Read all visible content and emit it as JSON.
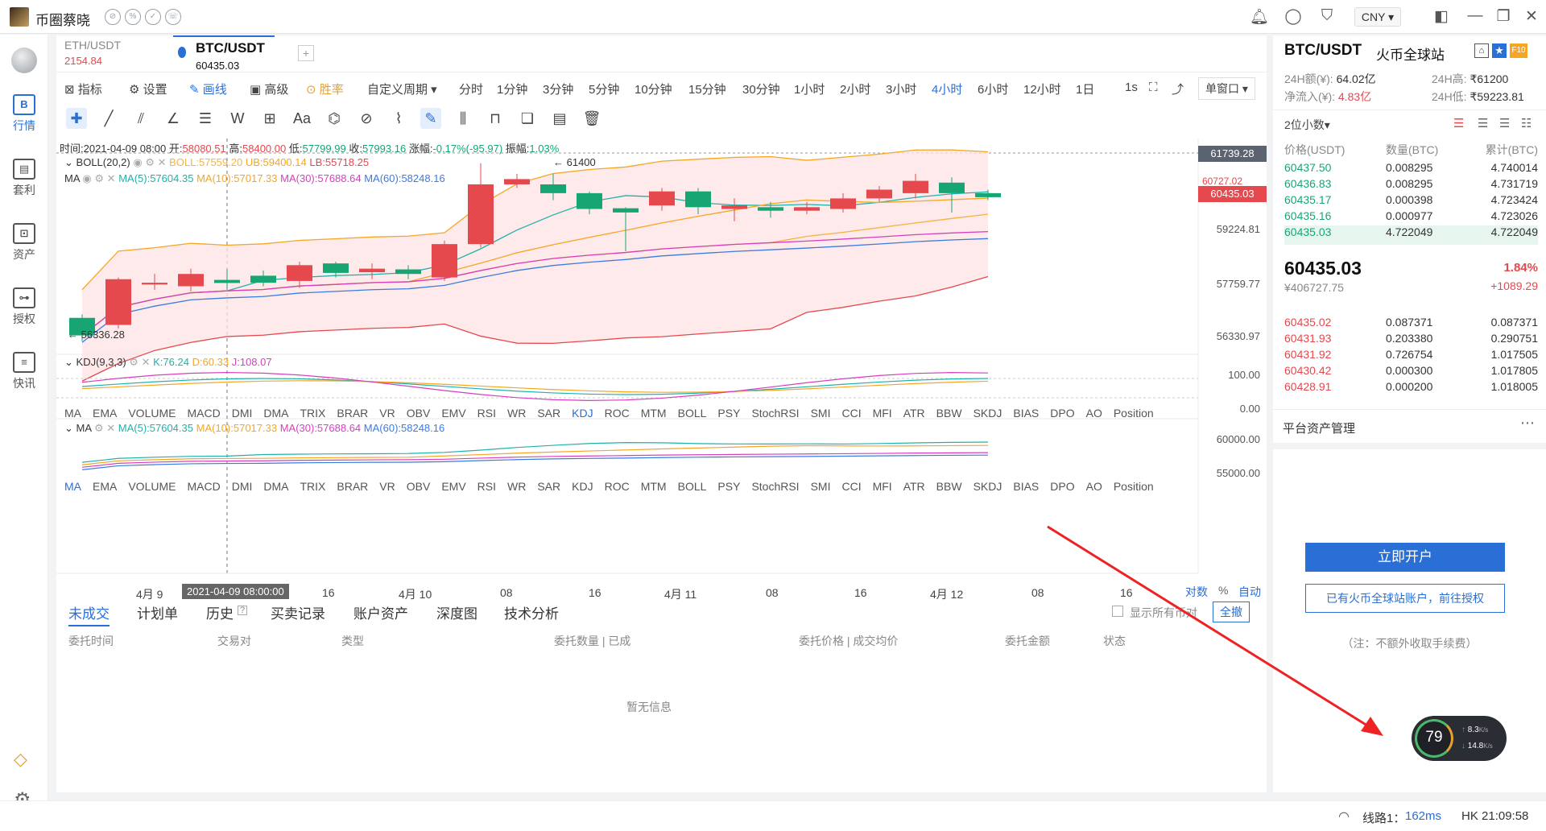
{
  "app": {
    "name": "币圈蔡晓",
    "badges": [
      "⊘",
      "%",
      "✓",
      "☏"
    ]
  },
  "topright": {
    "currency": "CNY"
  },
  "nav": [
    {
      "label": "行情",
      "icon": "B"
    },
    {
      "label": "套利",
      "icon": "▤"
    },
    {
      "label": "资产",
      "icon": "⊡"
    },
    {
      "label": "授权",
      "icon": "⊶"
    },
    {
      "label": "快讯",
      "icon": "≡"
    }
  ],
  "pairs": [
    {
      "name": "ETH/USDT",
      "value": "2154.84"
    },
    {
      "name": "BTC/USDT",
      "value": "60435.03"
    }
  ],
  "toolbar": {
    "items": [
      "指标",
      "设置",
      "画线",
      "高级",
      "胜率",
      "自定义周期"
    ],
    "periods": [
      "分时",
      "1分钟",
      "3分钟",
      "5分钟",
      "10分钟",
      "15分钟",
      "30分钟",
      "1小时",
      "2小时",
      "3小时",
      "4小时",
      "6小时",
      "12小时",
      "1日"
    ],
    "active_period": "4小时",
    "seconds": "1s",
    "window": "单窗口"
  },
  "info": {
    "time": "时间:2021-04-09 08:00",
    "open_l": "开:",
    "open": "58080.51",
    "high_l": "高:",
    "high": "58400.00",
    "low_l": "低:",
    "low": "57799.99",
    "close_l": "收:",
    "close": "57993.16",
    "chg_l": "涨幅:",
    "chg": "-0.17%(-95.97)",
    "amp_l": "振幅:",
    "amp": "1.03%"
  },
  "boll": {
    "name": "BOLL(20,2)",
    "boll": "BOLL:57559.20",
    "ub": "UB:59400.14",
    "lb": "LB:55718.25"
  },
  "ma_main": {
    "name": "MA",
    "ma5": "MA(5):57604.35",
    "ma10": "MA(10):57017.33",
    "ma30": "MA(30):57688.64",
    "ma60": "MA(60):58248.16"
  },
  "kdj": {
    "name": "KDJ(9,3,3)",
    "k": "K:76.24",
    "d": "D:60.33",
    "j": "J:108.07"
  },
  "ma_sub": {
    "name": "MA",
    "ma5": "MA(5):57604.35",
    "ma10": "MA(10):57017.33",
    "ma30": "MA(30):57688.64",
    "ma60": "MA(60):58248.16"
  },
  "indicators": [
    "MA",
    "EMA",
    "VOLUME",
    "MACD",
    "DMI",
    "DMA",
    "TRIX",
    "BRAR",
    "VR",
    "OBV",
    "EMV",
    "RSI",
    "WR",
    "SAR",
    "KDJ",
    "ROC",
    "MTM",
    "BOLL",
    "PSY",
    "StochRSI",
    "SMI",
    "CCI",
    "MFI",
    "ATR",
    "BBW",
    "SKDJ",
    "BIAS",
    "DPO",
    "AO",
    "Position"
  ],
  "axis": {
    "main": [
      "61739.28",
      "60435.03",
      "59224.81",
      "57759.77",
      "56330.97"
    ],
    "max_label": "← 61400",
    "min_label": "← 56336.28",
    "hidden_tick": "60727.02",
    "kdj": [
      "100.00",
      "0.00"
    ],
    "sub": [
      "60000.00",
      "55000.00"
    ],
    "time": [
      "4月 9",
      "2021-04-09 08:00:00",
      "16",
      "4月 10",
      "08",
      "16",
      "4月 11",
      "08",
      "16",
      "4月 12",
      "08",
      "16"
    ],
    "footer": [
      "对数",
      "%",
      "自动"
    ]
  },
  "orders": {
    "tabs": [
      "未成交",
      "计划单",
      "历史",
      "买卖记录",
      "账户资产",
      "深度图",
      "技术分析"
    ],
    "show_all": "显示所有币对",
    "cancel_all": "全撤",
    "headers": [
      "委托时间",
      "交易对",
      "类型",
      "委托数量 | 已成",
      "委托价格 | 成交均价",
      "委托金额",
      "状态"
    ],
    "empty": "暂无信息"
  },
  "right": {
    "pair": "BTC/USDT",
    "exchange": "火币全球站",
    "vol24_l": "24H额(¥):",
    "vol24": "64.02亿",
    "high24_l": "24H高:",
    "high24": "₹61200",
    "inflow_l": "净流入(¥):",
    "inflow": "4.83亿",
    "low24_l": "24H低:",
    "low24": "₹59223.81",
    "precision": "2位小数",
    "ob_headers": [
      "价格(USDT)",
      "数量(BTC)",
      "累计(BTC)"
    ],
    "asks": [
      [
        "60437.50",
        "0.008295",
        "4.740014"
      ],
      [
        "60436.83",
        "0.008295",
        "4.731719"
      ],
      [
        "60435.17",
        "0.000398",
        "4.723424"
      ],
      [
        "60435.16",
        "0.000977",
        "4.723026"
      ],
      [
        "60435.03",
        "4.722049",
        "4.722049"
      ]
    ],
    "last_price": "60435.03",
    "last_cny": "¥406727.75",
    "change_pct": "1.84%",
    "change_abs": "+1089.29",
    "bids": [
      [
        "60435.02",
        "0.087371",
        "0.087371"
      ],
      [
        "60431.93",
        "0.203380",
        "0.290751"
      ],
      [
        "60431.92",
        "0.726754",
        "1.017505"
      ],
      [
        "60430.42",
        "0.000300",
        "1.017805"
      ],
      [
        "60428.91",
        "0.000200",
        "1.018005"
      ]
    ],
    "asset_mgmt": "平台资产管理",
    "open_btn": "立即开户",
    "auth_btn": "已有火币全球站账户，前往授权",
    "note": "（注：不额外收取手续费）"
  },
  "speed": {
    "pct": "79",
    "up": "8.3",
    "down": "14.8",
    "unit": "K/s"
  },
  "status": {
    "line": "线路1：",
    "ping": "162ms",
    "clock": "HK 21:09:58"
  },
  "colors": {
    "up": "#e5484d",
    "down": "#17a673",
    "accent": "#2a6fd6"
  },
  "candles": [
    {
      "o": 57000,
      "c": 56500,
      "h": 57100,
      "l": 56336.28
    },
    {
      "o": 56800,
      "c": 58100,
      "h": 58150,
      "l": 56700
    },
    {
      "o": 57950,
      "c": 58000,
      "h": 58250,
      "l": 57800
    },
    {
      "o": 57900,
      "c": 58250,
      "h": 58400,
      "l": 57750
    },
    {
      "o": 58080.51,
      "c": 57993.16,
      "h": 58400,
      "l": 57799.99
    },
    {
      "o": 58200,
      "c": 58000,
      "h": 58350,
      "l": 57900
    },
    {
      "o": 58050,
      "c": 58500,
      "h": 58600,
      "l": 57850
    },
    {
      "o": 58550,
      "c": 58280,
      "h": 58600,
      "l": 58150
    },
    {
      "o": 58300,
      "c": 58400,
      "h": 58550,
      "l": 58100
    },
    {
      "o": 58380,
      "c": 58250,
      "h": 58500,
      "l": 58100
    },
    {
      "o": 58150,
      "c": 59100,
      "h": 59200,
      "l": 58050
    },
    {
      "o": 59100,
      "c": 60800,
      "h": 61400,
      "l": 59000
    },
    {
      "o": 60800,
      "c": 60950,
      "h": 61100,
      "l": 60700
    },
    {
      "o": 60800,
      "c": 60550,
      "h": 61100,
      "l": 60350
    },
    {
      "o": 60550,
      "c": 60100,
      "h": 60600,
      "l": 59950
    },
    {
      "o": 60120,
      "c": 60000,
      "h": 60150,
      "l": 58900
    },
    {
      "o": 60200,
      "c": 60600,
      "h": 60700,
      "l": 60050
    },
    {
      "o": 60600,
      "c": 60150,
      "h": 60700,
      "l": 59950
    },
    {
      "o": 60100,
      "c": 60200,
      "h": 60400,
      "l": 59750
    },
    {
      "o": 60150,
      "c": 60050,
      "h": 60300,
      "l": 59850
    },
    {
      "o": 60050,
      "c": 60150,
      "h": 60300,
      "l": 59950
    },
    {
      "o": 60100,
      "c": 60400,
      "h": 60550,
      "l": 60000
    },
    {
      "o": 60400,
      "c": 60650,
      "h": 60750,
      "l": 60300
    },
    {
      "o": 60550,
      "c": 60900,
      "h": 61100,
      "l": 60400
    },
    {
      "o": 60850,
      "c": 60550,
      "h": 61000,
      "l": 60000
    },
    {
      "o": 60550,
      "c": 60435.03,
      "h": 60650,
      "l": 60350
    }
  ]
}
